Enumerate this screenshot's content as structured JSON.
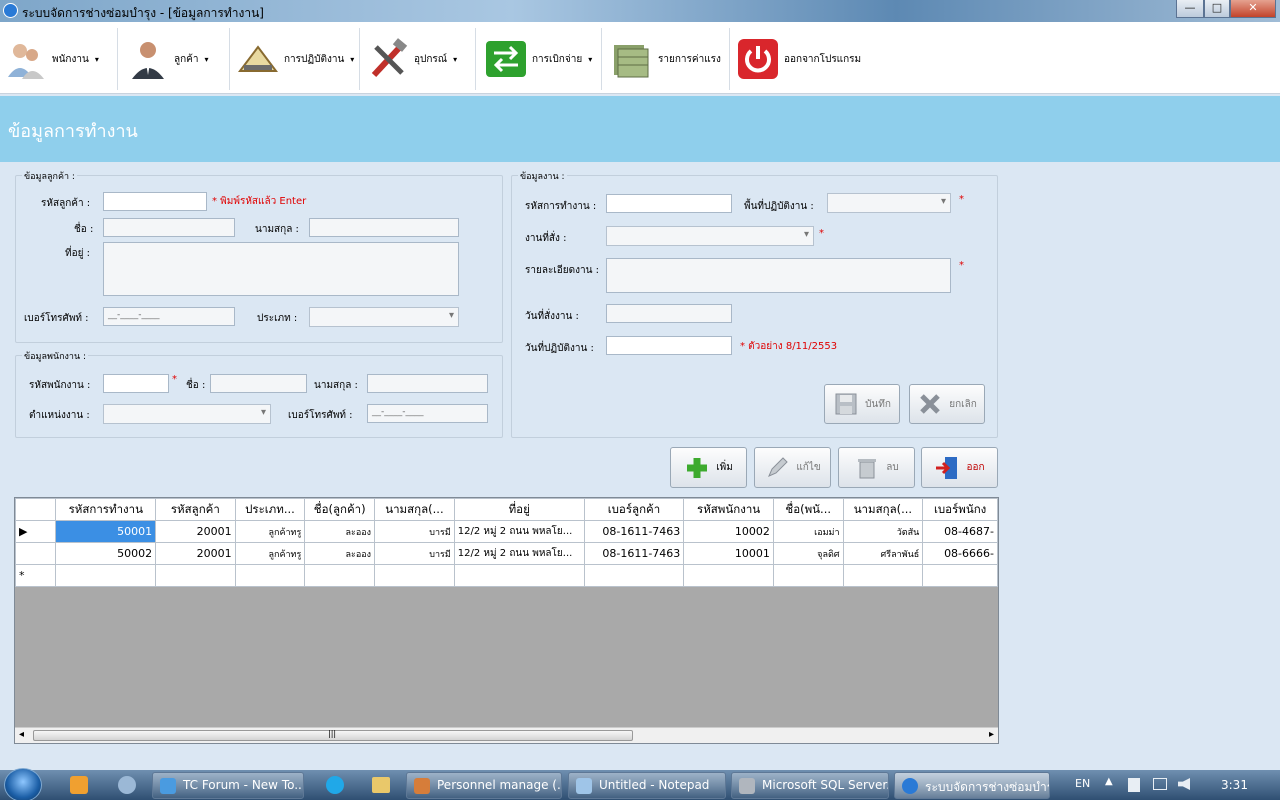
{
  "window": {
    "title": "ระบบจัดการช่างซ่อมบำรุง - [ข้อมูลการทำงาน]",
    "minimize": "—",
    "maximize": "□",
    "close": "✕"
  },
  "menu": [
    {
      "label": "พนักงาน",
      "arrow": "▾",
      "icon": "employees-icon"
    },
    {
      "label": "ลูกค้า",
      "arrow": "▾",
      "icon": "customer-icon"
    },
    {
      "label": "การปฏิบัติงาน",
      "arrow": "▾",
      "icon": "operation-tools-icon"
    },
    {
      "label": "อุปกรณ์",
      "arrow": "▾",
      "icon": "equipment-tools-icon"
    },
    {
      "label": "การเบิกจ่าย",
      "arrow": "▾",
      "icon": "exchange-arrows-icon"
    },
    {
      "label": "รายการค่าแรง",
      "arrow": "",
      "icon": "money-stack-icon"
    },
    {
      "label": "ออกจากโปรแกรม",
      "arrow": "",
      "icon": "power-icon"
    }
  ],
  "page_title": "ข้อมูลการทำงาน",
  "customer": {
    "legend": "ข้อมูลลูกค้า :",
    "id_label": "รหัสลูกค้า :",
    "id_hint": "* พิมพ์รหัสแล้ว Enter",
    "name_label": "ชื่อ :",
    "surname_label": "นามสกุล :",
    "address_label": "ที่อยู่ :",
    "phone_label": "เบอร์โทรศัพท์ :",
    "phone_mask": "__-____-____",
    "type_label": "ประเภท :"
  },
  "employee": {
    "legend": "ข้อมูลพนักงาน :",
    "id_label": "รหัสพนักงาน :",
    "req": "*",
    "name_label": "ชื่อ :",
    "surname_label": "นามสกุล :",
    "position_label": "ตำแหน่งงาน :",
    "phone_label": "เบอร์โทรศัพท์ :",
    "phone_mask": "__-____-____"
  },
  "job": {
    "legend": "ข้อมูลงาน :",
    "work_id_label": "รหัสการทำงาน :",
    "area_label": "พื้นที่ปฏิบัติงาน :",
    "req": "*",
    "type_label": "งานที่สั่ง :",
    "detail_label": "รายละเอียดงาน :",
    "order_date_label": "วันที่สั่งงาน :",
    "work_date_label": "วันที่ปฏิบัติงาน :",
    "date_example": "* ตัวอย่าง 8/11/2553"
  },
  "buttons": {
    "save": "บันทึก",
    "cancel": "ยกเลิก",
    "add": "เพิ่ม",
    "edit": "แก้ไข",
    "delete": "ลบ",
    "exit": "ออก"
  },
  "grid": {
    "columns": [
      "รหัสการทำงาน",
      "รหัสลูกค้า",
      "ประเภท...",
      "ชื่อ(ลูกค้า)",
      "นามสกุล(...",
      "ที่อยู่",
      "เบอร์ลูกค้า",
      "รหัสพนักงาน",
      "ชื่อ(พนั...",
      "นามสกุล(...",
      "เบอร์พนักง"
    ],
    "rows": [
      [
        "50001",
        "20001",
        "ลูกค้าทรู",
        "ละออง",
        "บารมี",
        "12/2 หมู่ 2 ถนน พหลโย...",
        "08-1611-7463",
        "10002",
        "เอมม่า",
        "วัตสัน",
        "08-4687-"
      ],
      [
        "50002",
        "20001",
        "ลูกค้าทรู",
        "ละออง",
        "บารมี",
        "12/2 หมู่ 2 ถนน พหลโย...",
        "08-1611-7463",
        "10001",
        "จุลดิศ",
        "ศรีลาพันธ์",
        "08-6666-"
      ]
    ],
    "current_marker": "▶",
    "new_marker": "*",
    "scroll_left": "◂",
    "scroll_right": "▸",
    "scroll_grip": "|||"
  },
  "taskbar": {
    "items": [
      "TC Forum - New To...",
      "Personnel manage (...",
      "Untitled - Notepad",
      "Microsoft SQL Server...",
      "ระบบจัดการช่างซ่อมบำร..."
    ],
    "lang": "EN",
    "time": "3:31"
  }
}
